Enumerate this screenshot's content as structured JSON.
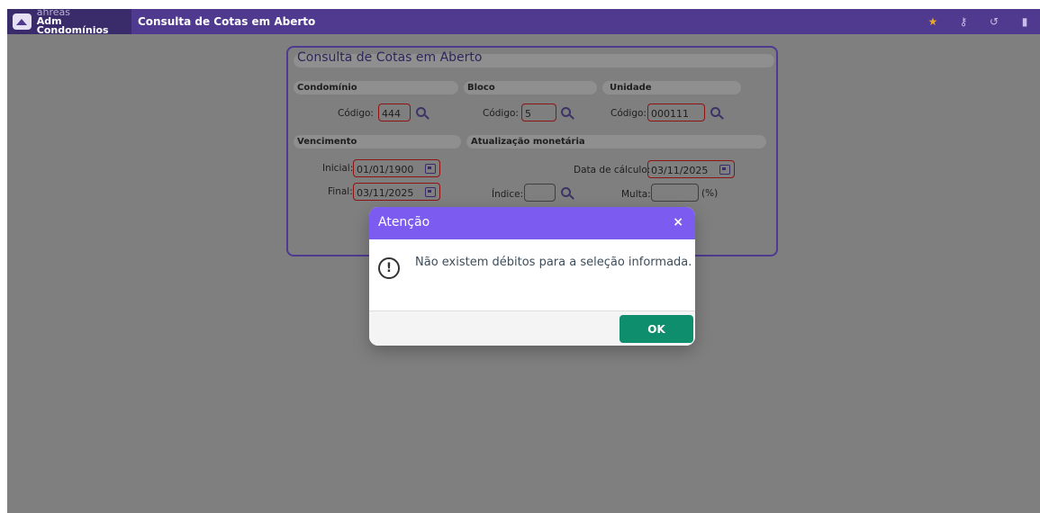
{
  "app": {
    "brand_line1": "ahreas",
    "brand_line2": "Adm Condomínios",
    "window_title": "Consulta de Cotas em Aberto",
    "top_icons": [
      "star-icon",
      "key-icon",
      "history-icon",
      "book-icon"
    ]
  },
  "panel": {
    "title": "Consulta de Cotas em Aberto",
    "condominio": {
      "label": "Condomínio",
      "codigo_label": "Código:",
      "codigo_value": "444"
    },
    "bloco": {
      "label": "Bloco",
      "codigo_label": "Código:",
      "codigo_value": "5"
    },
    "unidade": {
      "label": "Unidade",
      "codigo_label": "Código:",
      "codigo_value": "000111"
    },
    "vencimento": {
      "label": "Vencimento",
      "inicial_label": "Inicial:",
      "inicial_value": "01/01/1900",
      "final_label": "Final:",
      "final_value": "03/11/2025"
    },
    "atualizacao": {
      "label": "Atualização monetária",
      "data_calculo_label": "Data de cálculo:",
      "data_calculo_value": "03/11/2025",
      "indice_label": "Índice:",
      "indice_value": "",
      "multa_label": "Multa:",
      "multa_value": "",
      "multa_unit": "(%)"
    }
  },
  "dialog": {
    "title": "Atenção",
    "close_symbol": "×",
    "message": "Não existem débitos para a seleção informada.",
    "ok_label": "OK"
  },
  "colors": {
    "topbar": "#4f3a8f",
    "dialog_header": "#7c5cf0",
    "ok_button": "#0f8e6e",
    "invalid_border": "#8e1414"
  }
}
